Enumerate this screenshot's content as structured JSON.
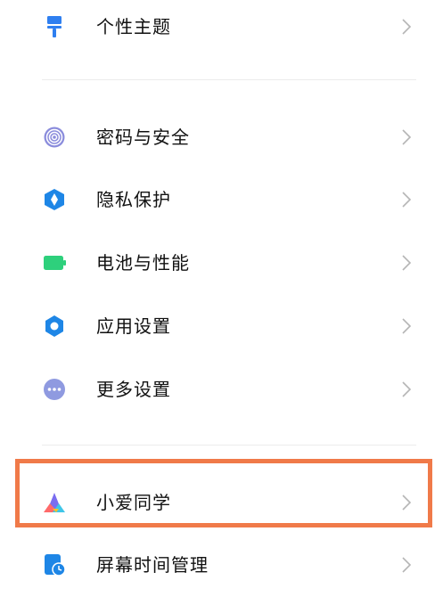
{
  "settings": {
    "items": [
      {
        "label": "个性主题",
        "icon": "paint-roller-icon",
        "color": "#2f7ff0"
      },
      {
        "label": "密码与安全",
        "icon": "fingerprint-icon",
        "color": "#6b6dcc"
      },
      {
        "label": "隐私保护",
        "icon": "shield-icon",
        "color": "#1e86e6"
      },
      {
        "label": "电池与性能",
        "icon": "battery-icon",
        "color": "#2ed07c"
      },
      {
        "label": "应用设置",
        "icon": "gear-icon",
        "color": "#1e86e6"
      },
      {
        "label": "更多设置",
        "icon": "more-dots-icon",
        "color": "#8f9ae0"
      },
      {
        "label": "小爱同学",
        "icon": "xiaoai-logo-icon",
        "color": "#7a6df0"
      },
      {
        "label": "屏幕时间管理",
        "icon": "screen-time-icon",
        "color": "#1e86e6"
      }
    ]
  },
  "highlight": {
    "color": "#f07a49",
    "target": "小爱同学"
  }
}
